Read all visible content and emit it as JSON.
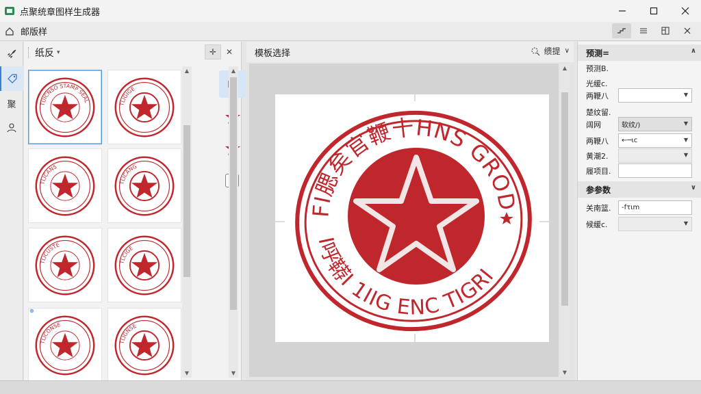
{
  "window": {
    "title": "点聚统章图样生成器",
    "controls": [
      "minimize-icon",
      "maximize-icon",
      "close-icon"
    ]
  },
  "toolbar": {
    "title": "邮版样",
    "buttons": [
      "align-icon",
      "menu-icon",
      "layout-icon",
      "close-icon"
    ]
  },
  "activity_bar": {
    "items": [
      {
        "icon": "rocket-icon"
      },
      {
        "icon": "tag-icon",
        "active": true
      },
      {
        "label": "聚"
      },
      {
        "icon": "user-icon"
      }
    ]
  },
  "gallery": {
    "title": "纸反",
    "head_buttons": [
      "move-icon",
      "close-icon"
    ],
    "badge": "⊕",
    "thumbnails": [
      {
        "ring_text": "TUICNSO STAMP SEAL",
        "selected": true
      },
      {
        "ring_text": "TLIGIGE"
      },
      {
        "ring_text": "TLICANS"
      },
      {
        "ring_text": "TLICANG"
      },
      {
        "ring_text": "TLICUSTE"
      },
      {
        "ring_text": "TLCIGE"
      },
      {
        "ring_text": "TLICONSE"
      },
      {
        "ring_text": "TLIGNSE"
      }
    ],
    "side_tools": [
      "shape-icon",
      "star-icon",
      "star-icon",
      "add-icon"
    ]
  },
  "canvas": {
    "title": "模板选择",
    "zoom_label": "缋提",
    "stamp": {
      "top_text": "FI腮矣官鞭十HNS GRODIC",
      "bottom_text": "I呼鞯I 1IIG ENC TIGRI",
      "color": "#c0272d"
    }
  },
  "properties": {
    "sections": [
      {
        "title": "预测=",
        "rows": [
          {
            "label": "预测B.",
            "field": null
          },
          {
            "label": "光缓c.",
            "field": null
          },
          {
            "label": "两鞭八",
            "field": {
              "value": "",
              "dropdown": true
            }
          },
          {
            "label": "楚纹留.",
            "field": null
          },
          {
            "label": "阔网",
            "field": {
              "value": "软纹/)",
              "dropdown": true,
              "style": "dark"
            }
          },
          {
            "label": "两鞭八",
            "field": {
              "value": "←─ιc",
              "dropdown": true
            }
          },
          {
            "label": "黄潮2.",
            "field": {
              "value": "",
              "dropdown": true,
              "style": "disabled"
            }
          },
          {
            "label": "履项目.",
            "field": {
              "value": "",
              "dropdown": false
            }
          }
        ]
      },
      {
        "title": "参参数",
        "rows": [
          {
            "label": "关南篮.",
            "field": {
              "value": "-fτιm",
              "dropdown": false
            }
          },
          {
            "label": "候缓c.",
            "field": {
              "value": "",
              "dropdown": true,
              "style": "disabled"
            }
          }
        ]
      }
    ]
  }
}
